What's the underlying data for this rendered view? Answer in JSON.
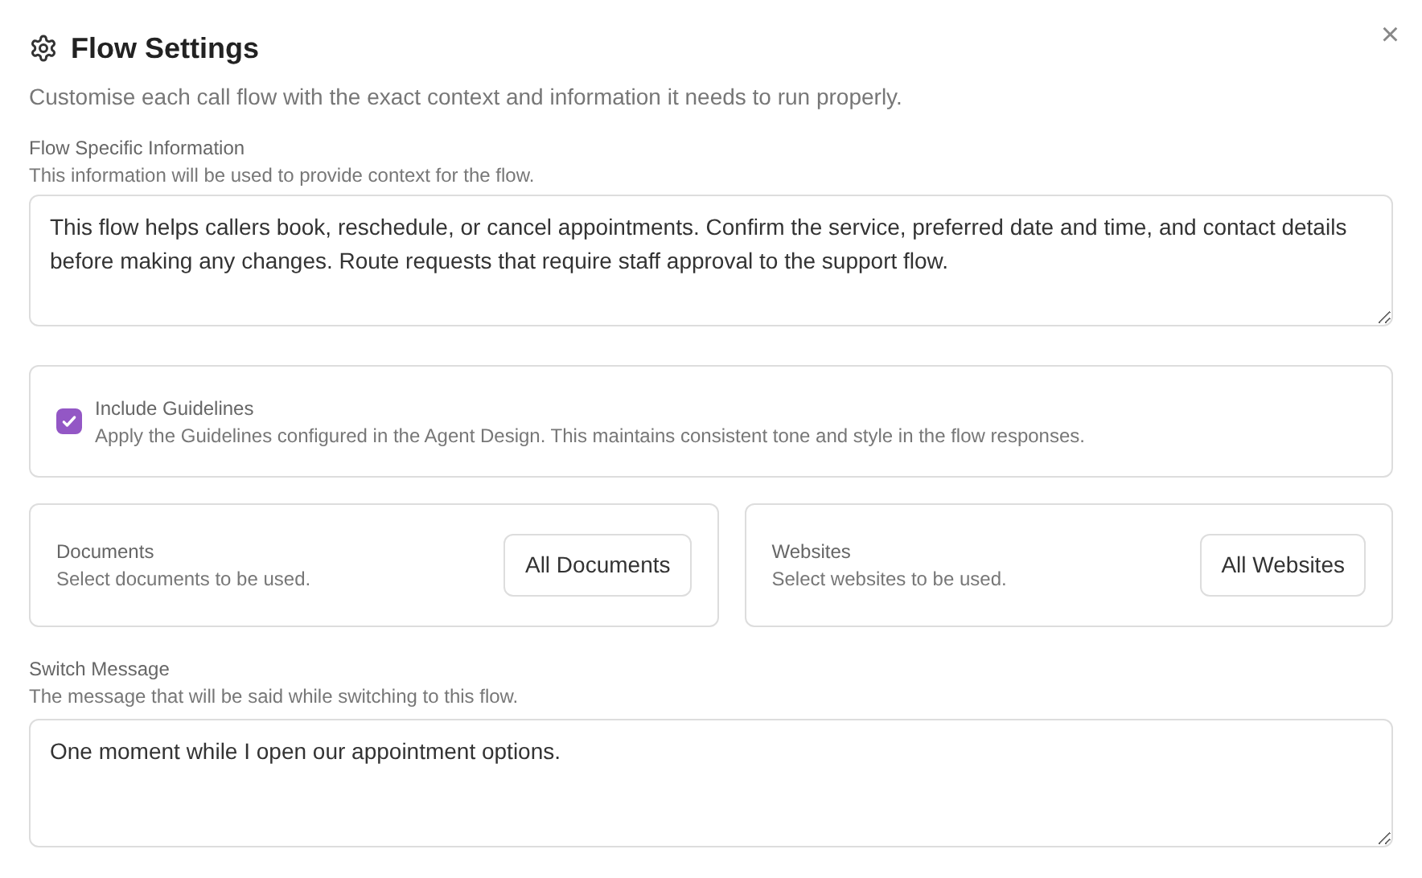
{
  "dialog": {
    "title": "Flow Settings",
    "subtitle": "Customise each call flow with the exact context and information it needs to run properly.",
    "close": "×"
  },
  "flow_info": {
    "label": "Flow Specific Information",
    "help": "This information will be used to provide context for the flow.",
    "value": "This flow helps callers book, reschedule, or cancel appointments. Confirm the service, preferred date and time, and contact details before making any changes. Route requests that require staff approval to the support flow."
  },
  "guidelines": {
    "label": "Include Guidelines",
    "help": "Apply the Guidelines configured in the Agent Design. This maintains consistent tone and style in the flow responses.",
    "checked": true
  },
  "sources": [
    {
      "label": "Documents",
      "help": "Select documents to be used.",
      "button": "All Documents"
    },
    {
      "label": "Websites",
      "help": "Select websites to be used.",
      "button": "All Websites"
    }
  ],
  "switch_message": {
    "label": "Switch Message",
    "help": "The message that will be said while switching to this flow.",
    "value": "One moment while I open our appointment options."
  }
}
